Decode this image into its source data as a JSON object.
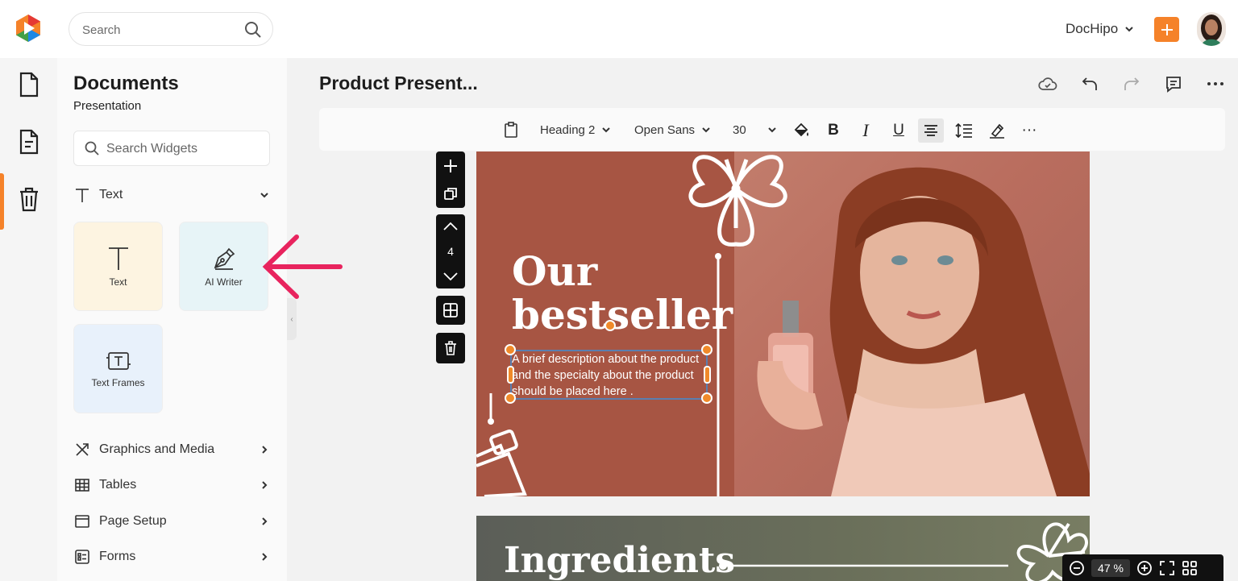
{
  "header": {
    "search_placeholder": "Search",
    "brand": "DocHipo"
  },
  "sidebar": {
    "title": "Documents",
    "subtitle": "Presentation",
    "widget_search_placeholder": "Search Widgets",
    "text_section": "Text",
    "tiles": [
      {
        "label": "Text",
        "icon": "text-t-icon"
      },
      {
        "label": "AI Writer",
        "icon": "pen-nib-icon"
      },
      {
        "label": "Text Frames",
        "icon": "text-frame-icon"
      }
    ],
    "sections": [
      {
        "label": "Graphics and Media",
        "icon": "graphics-icon"
      },
      {
        "label": "Tables",
        "icon": "table-icon"
      },
      {
        "label": "Page Setup",
        "icon": "page-setup-icon"
      },
      {
        "label": "Forms",
        "icon": "forms-icon"
      }
    ]
  },
  "document": {
    "title": "Product Present..."
  },
  "toolbar": {
    "heading": "Heading 2",
    "font": "Open Sans",
    "size": "30",
    "bold": "B",
    "italic": "I",
    "underline": "U",
    "more": "···"
  },
  "page_tools": {
    "page_number": "4"
  },
  "slide1": {
    "heading_line1": "Our",
    "heading_line2": "bestseller",
    "description": "A brief description about the product and the specialty about the product should be placed here ."
  },
  "slide2": {
    "title": "Ingredients"
  },
  "zoom": {
    "value": "47",
    "unit": "%"
  },
  "colors": {
    "accent": "#f58229",
    "slide_bg": "#a75543",
    "annotation_arrow": "#e8245e"
  }
}
